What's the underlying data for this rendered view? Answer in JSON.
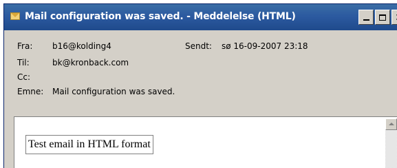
{
  "window": {
    "title": "Mail configuration was saved. - Meddelelse (HTML)"
  },
  "header": {
    "from_label": "Fra:",
    "from_value": "b16@kolding4",
    "sent_label": "Sendt:",
    "sent_value": "sø 16-09-2007 23:18",
    "to_label": "Til:",
    "to_value": "bk@kronback.com",
    "cc_label": "Cc:",
    "cc_value": "",
    "subject_label": "Emne:",
    "subject_value": "Mail configuration was saved."
  },
  "body": {
    "message_text": "Test email in HTML format"
  },
  "icons": {
    "title_icon": "envelope-icon",
    "minimize": "minimize-icon",
    "maximize": "maximize-icon",
    "close": "close-icon",
    "scroll_up": "scroll-up-arrow-icon"
  },
  "colors": {
    "titlebar": "#2c5aa0",
    "window_background": "#d4d0c8",
    "message_background": "#ffffff"
  }
}
